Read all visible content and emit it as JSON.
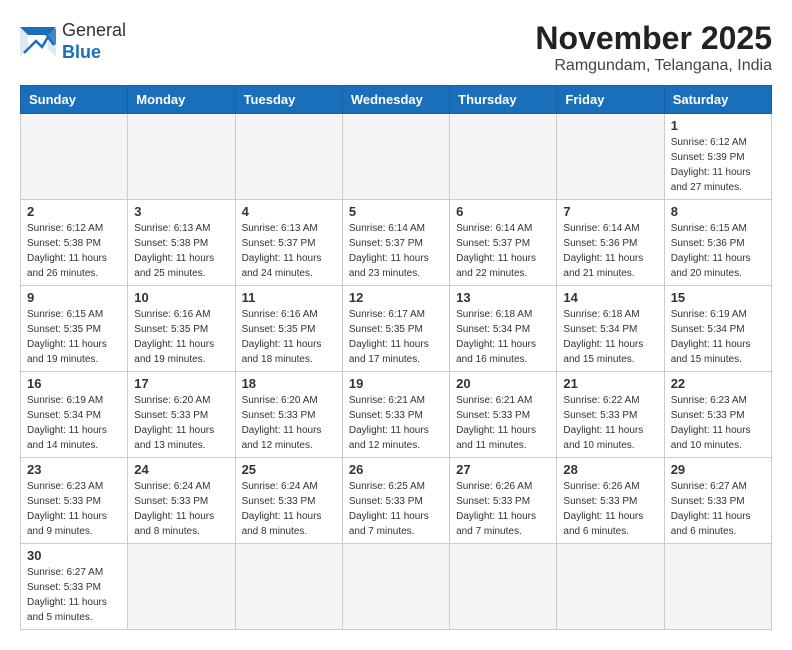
{
  "logo": {
    "general": "General",
    "blue": "Blue"
  },
  "title": "November 2025",
  "location": "Ramgundam, Telangana, India",
  "headers": [
    "Sunday",
    "Monday",
    "Tuesday",
    "Wednesday",
    "Thursday",
    "Friday",
    "Saturday"
  ],
  "days": [
    {
      "num": "",
      "info": ""
    },
    {
      "num": "",
      "info": ""
    },
    {
      "num": "",
      "info": ""
    },
    {
      "num": "",
      "info": ""
    },
    {
      "num": "",
      "info": ""
    },
    {
      "num": "",
      "info": ""
    },
    {
      "num": "1",
      "info": "Sunrise: 6:12 AM\nSunset: 5:39 PM\nDaylight: 11 hours\nand 27 minutes."
    },
    {
      "num": "2",
      "info": "Sunrise: 6:12 AM\nSunset: 5:38 PM\nDaylight: 11 hours\nand 26 minutes."
    },
    {
      "num": "3",
      "info": "Sunrise: 6:13 AM\nSunset: 5:38 PM\nDaylight: 11 hours\nand 25 minutes."
    },
    {
      "num": "4",
      "info": "Sunrise: 6:13 AM\nSunset: 5:37 PM\nDaylight: 11 hours\nand 24 minutes."
    },
    {
      "num": "5",
      "info": "Sunrise: 6:14 AM\nSunset: 5:37 PM\nDaylight: 11 hours\nand 23 minutes."
    },
    {
      "num": "6",
      "info": "Sunrise: 6:14 AM\nSunset: 5:37 PM\nDaylight: 11 hours\nand 22 minutes."
    },
    {
      "num": "7",
      "info": "Sunrise: 6:14 AM\nSunset: 5:36 PM\nDaylight: 11 hours\nand 21 minutes."
    },
    {
      "num": "8",
      "info": "Sunrise: 6:15 AM\nSunset: 5:36 PM\nDaylight: 11 hours\nand 20 minutes."
    },
    {
      "num": "9",
      "info": "Sunrise: 6:15 AM\nSunset: 5:35 PM\nDaylight: 11 hours\nand 19 minutes."
    },
    {
      "num": "10",
      "info": "Sunrise: 6:16 AM\nSunset: 5:35 PM\nDaylight: 11 hours\nand 19 minutes."
    },
    {
      "num": "11",
      "info": "Sunrise: 6:16 AM\nSunset: 5:35 PM\nDaylight: 11 hours\nand 18 minutes."
    },
    {
      "num": "12",
      "info": "Sunrise: 6:17 AM\nSunset: 5:35 PM\nDaylight: 11 hours\nand 17 minutes."
    },
    {
      "num": "13",
      "info": "Sunrise: 6:18 AM\nSunset: 5:34 PM\nDaylight: 11 hours\nand 16 minutes."
    },
    {
      "num": "14",
      "info": "Sunrise: 6:18 AM\nSunset: 5:34 PM\nDaylight: 11 hours\nand 15 minutes."
    },
    {
      "num": "15",
      "info": "Sunrise: 6:19 AM\nSunset: 5:34 PM\nDaylight: 11 hours\nand 15 minutes."
    },
    {
      "num": "16",
      "info": "Sunrise: 6:19 AM\nSunset: 5:34 PM\nDaylight: 11 hours\nand 14 minutes."
    },
    {
      "num": "17",
      "info": "Sunrise: 6:20 AM\nSunset: 5:33 PM\nDaylight: 11 hours\nand 13 minutes."
    },
    {
      "num": "18",
      "info": "Sunrise: 6:20 AM\nSunset: 5:33 PM\nDaylight: 11 hours\nand 12 minutes."
    },
    {
      "num": "19",
      "info": "Sunrise: 6:21 AM\nSunset: 5:33 PM\nDaylight: 11 hours\nand 12 minutes."
    },
    {
      "num": "20",
      "info": "Sunrise: 6:21 AM\nSunset: 5:33 PM\nDaylight: 11 hours\nand 11 minutes."
    },
    {
      "num": "21",
      "info": "Sunrise: 6:22 AM\nSunset: 5:33 PM\nDaylight: 11 hours\nand 10 minutes."
    },
    {
      "num": "22",
      "info": "Sunrise: 6:23 AM\nSunset: 5:33 PM\nDaylight: 11 hours\nand 10 minutes."
    },
    {
      "num": "23",
      "info": "Sunrise: 6:23 AM\nSunset: 5:33 PM\nDaylight: 11 hours\nand 9 minutes."
    },
    {
      "num": "24",
      "info": "Sunrise: 6:24 AM\nSunset: 5:33 PM\nDaylight: 11 hours\nand 8 minutes."
    },
    {
      "num": "25",
      "info": "Sunrise: 6:24 AM\nSunset: 5:33 PM\nDaylight: 11 hours\nand 8 minutes."
    },
    {
      "num": "26",
      "info": "Sunrise: 6:25 AM\nSunset: 5:33 PM\nDaylight: 11 hours\nand 7 minutes."
    },
    {
      "num": "27",
      "info": "Sunrise: 6:26 AM\nSunset: 5:33 PM\nDaylight: 11 hours\nand 7 minutes."
    },
    {
      "num": "28",
      "info": "Sunrise: 6:26 AM\nSunset: 5:33 PM\nDaylight: 11 hours\nand 6 minutes."
    },
    {
      "num": "29",
      "info": "Sunrise: 6:27 AM\nSunset: 5:33 PM\nDaylight: 11 hours\nand 6 minutes."
    },
    {
      "num": "30",
      "info": "Sunrise: 6:27 AM\nSunset: 5:33 PM\nDaylight: 11 hours\nand 5 minutes."
    }
  ]
}
